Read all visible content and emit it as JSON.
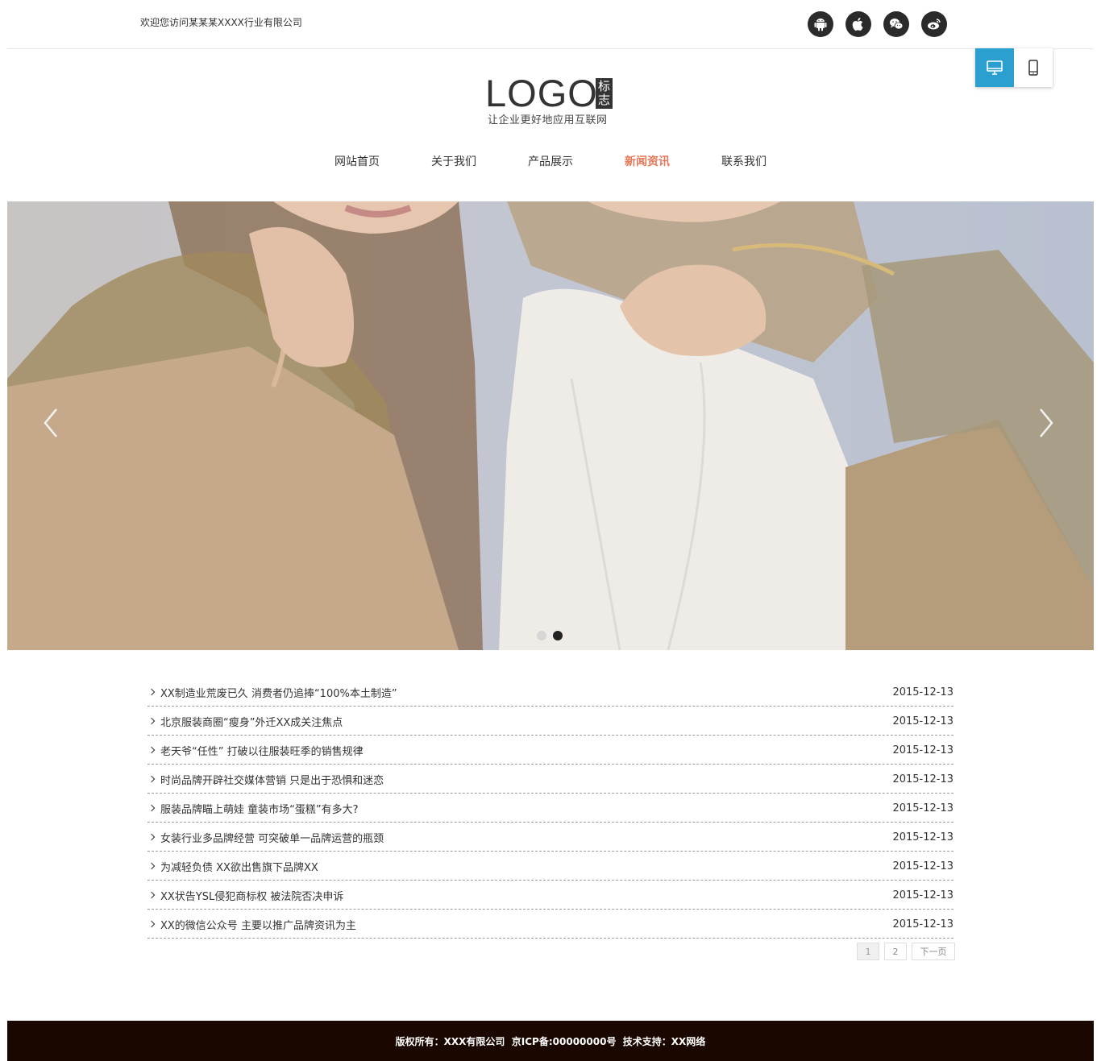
{
  "topbar": {
    "welcome": "欢迎您访问某某某XXXX行业有限公司",
    "icons": [
      "android-icon",
      "apple-icon",
      "wechat-icon",
      "weibo-icon"
    ]
  },
  "logo": {
    "text": "LOGO",
    "badge": "标志",
    "slogan": "让企业更好地应用互联网"
  },
  "nav": {
    "items": [
      "网站首页",
      "关于我们",
      "产品展示",
      "新闻资讯",
      "联系我们"
    ],
    "active": "新闻资讯"
  },
  "banner": {
    "slide_count": 2,
    "active_slide": 2
  },
  "news": {
    "items": [
      {
        "title": "XX制造业荒废已久 消费者仍追捧“100%本土制造”",
        "date": "2015-12-13"
      },
      {
        "title": "北京服装商圈“瘦身”外迁XX成关注焦点",
        "date": "2015-12-13"
      },
      {
        "title": "老天爷“任性” 打破以往服装旺季的销售规律",
        "date": "2015-12-13"
      },
      {
        "title": "时尚品牌开辟社交媒体营销 只是出于恐惧和迷恋",
        "date": "2015-12-13"
      },
      {
        "title": "服装品牌瞄上萌娃 童装市场“蛋糕”有多大?",
        "date": "2015-12-13"
      },
      {
        "title": "女装行业多品牌经营 可突破单一品牌运营的瓶颈",
        "date": "2015-12-13"
      },
      {
        "title": "为减轻负债 XX欲出售旗下品牌XX",
        "date": "2015-12-13"
      },
      {
        "title": "XX状告YSL侵犯商标权 被法院否决申诉",
        "date": "2015-12-13"
      },
      {
        "title": "XX的微信公众号 主要以推广品牌资讯为主",
        "date": "2015-12-13"
      }
    ]
  },
  "pager": {
    "page1": "1",
    "page2": "2",
    "next": "下一页"
  },
  "footer": {
    "text": "版权所有：XXX有限公司  京ICP备:00000000号  技术支持：XX网络"
  },
  "colors": {
    "accent_nav": "#e8785a",
    "view_switch_active": "#2a9fd0",
    "footer_bg": "#1a0700"
  }
}
